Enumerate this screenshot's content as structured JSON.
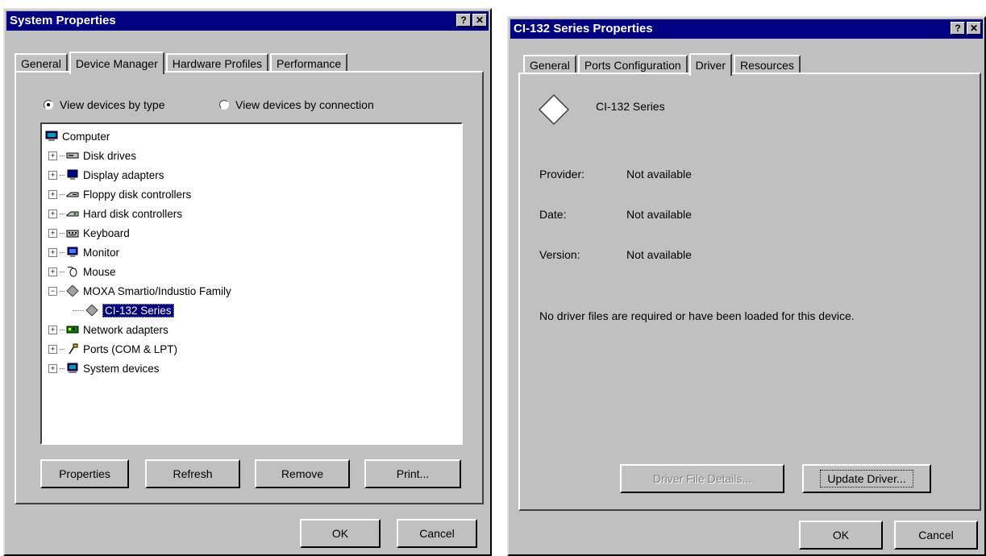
{
  "left": {
    "title": "System Properties",
    "help_btn": "?",
    "close_btn": "✕",
    "tabs": [
      "General",
      "Device Manager",
      "Hardware Profiles",
      "Performance"
    ],
    "radio_by_type": "View devices by type",
    "radio_by_connection": "View devices by connection",
    "tree": {
      "root": "Computer",
      "items": [
        "Disk drives",
        "Display adapters",
        "Floppy disk controllers",
        "Hard disk controllers",
        "Keyboard",
        "Monitor",
        "Mouse",
        "MOXA Smartio/Industio Family"
      ],
      "child": "CI-132 Series",
      "items_after": [
        "Network adapters",
        "Ports (COM & LPT)",
        "System devices"
      ]
    },
    "buttons": {
      "properties": "Properties",
      "refresh": "Refresh",
      "remove": "Remove",
      "print": "Print..."
    },
    "ok": "OK",
    "cancel": "Cancel"
  },
  "right": {
    "title": "CI-132 Series Properties",
    "help_btn": "?",
    "close_btn": "✕",
    "tabs": [
      "General",
      "Ports Configuration",
      "Driver",
      "Resources"
    ],
    "device_name": "CI-132 Series",
    "provider_label": "Provider:",
    "provider_value": "Not available",
    "date_label": "Date:",
    "date_value": "Not available",
    "version_label": "Version:",
    "version_value": "Not available",
    "message": "No driver files are required or have been loaded for this device.",
    "driver_file_details": "Driver File Details...",
    "update_driver": "Update Driver...",
    "ok": "OK",
    "cancel": "Cancel"
  }
}
